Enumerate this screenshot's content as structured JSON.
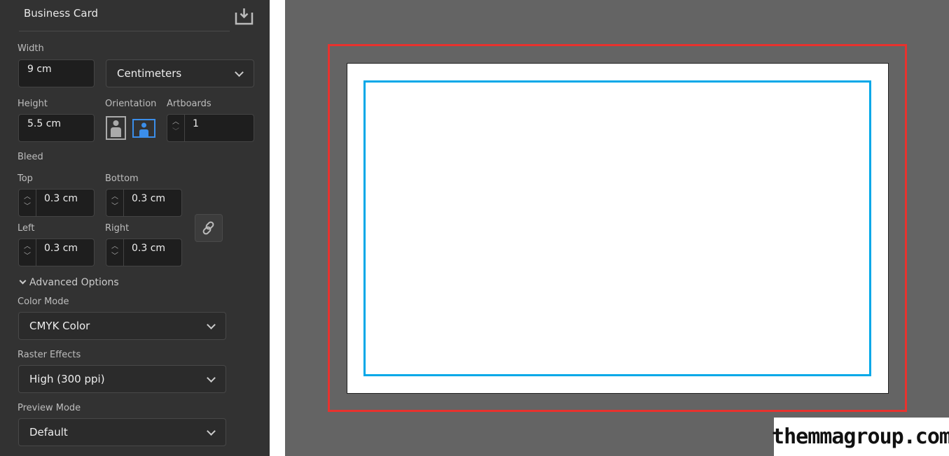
{
  "panel": {
    "title": "Business Card",
    "width": {
      "label": "Width",
      "value": "9 cm"
    },
    "units": {
      "value": "Centimeters"
    },
    "height": {
      "label": "Height",
      "value": "5.5 cm"
    },
    "orientation": {
      "label": "Orientation",
      "selected": "landscape"
    },
    "artboards": {
      "label": "Artboards",
      "value": "1"
    },
    "bleed": {
      "label": "Bleed",
      "top": {
        "label": "Top",
        "value": "0.3 cm"
      },
      "bottom": {
        "label": "Bottom",
        "value": "0.3 cm"
      },
      "left": {
        "label": "Left",
        "value": "0.3 cm"
      },
      "right": {
        "label": "Right",
        "value": "0.3 cm"
      }
    },
    "advanced_label": "Advanced Options",
    "color_mode": {
      "label": "Color Mode",
      "value": "CMYK Color"
    },
    "raster": {
      "label": "Raster Effects",
      "value": "High (300 ppi)"
    },
    "preview": {
      "label": "Preview Mode",
      "value": "Default"
    }
  },
  "colors": {
    "bleed_outline": "#e8322e",
    "margin_outline": "#00a8e8",
    "accent": "#3b8eea"
  },
  "watermark": "themmagroup.com"
}
